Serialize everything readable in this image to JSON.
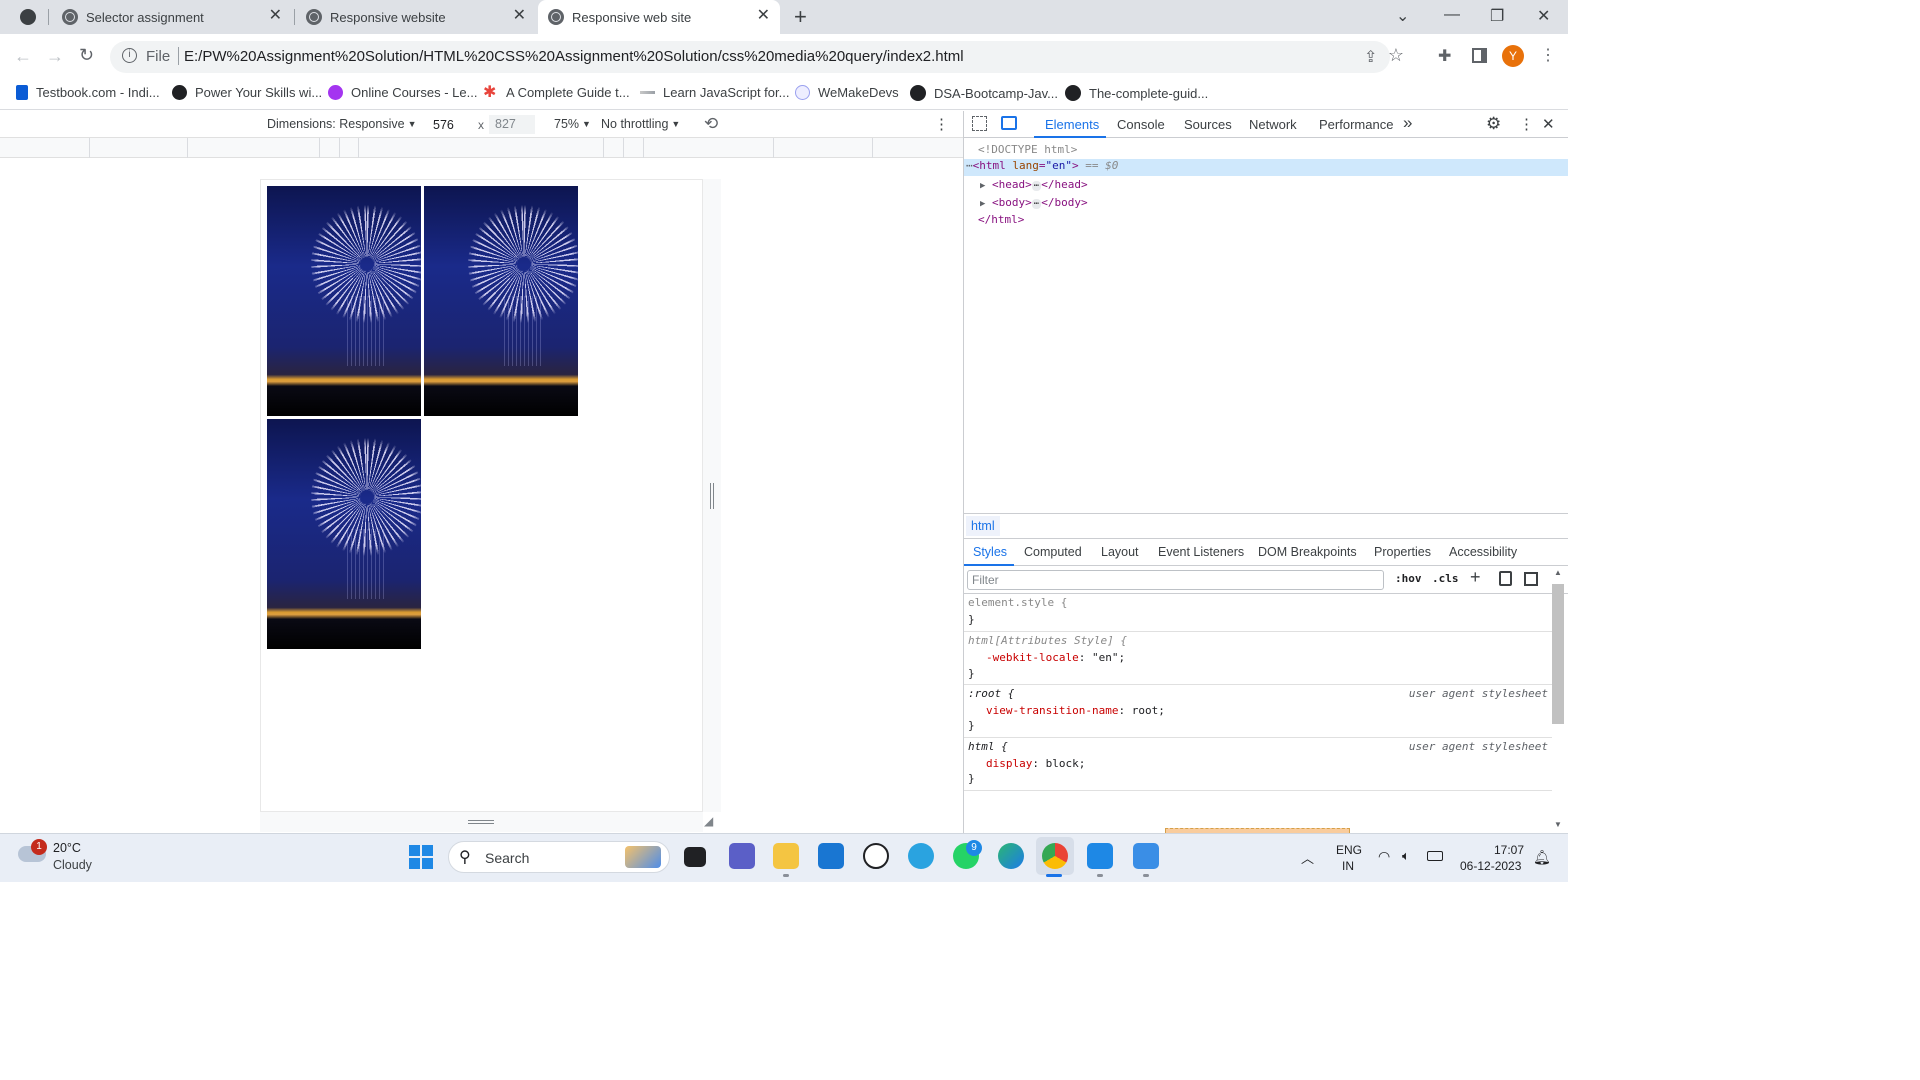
{
  "browser": {
    "tabs": [
      {
        "title": "Selector assignment"
      },
      {
        "title": "Responsive website"
      },
      {
        "title": "Responsive web site"
      }
    ],
    "new_tab_icon": "plus-icon",
    "address": {
      "scheme_label": "File",
      "url": "E:/PW%20Assignment%20Solution/HTML%20CSS%20Assignment%20Solution/css%20media%20query/index2.html"
    },
    "profile_initial": "Y",
    "profile_color": "#e8710a",
    "bookmarks": [
      {
        "label": "Testbook.com - Indi..."
      },
      {
        "label": "Power Your Skills wi..."
      },
      {
        "label": "Online Courses - Le..."
      },
      {
        "label": "A Complete Guide t..."
      },
      {
        "label": "Learn JavaScript for..."
      },
      {
        "label": "WeMakeDevs"
      },
      {
        "label": "DSA-Bootcamp-Jav..."
      },
      {
        "label": "The-complete-guid..."
      }
    ]
  },
  "device_toolbar": {
    "dimensions_label": "Dimensions: Responsive",
    "width": "576",
    "height_placeholder": "827",
    "times": "x",
    "zoom": "75%",
    "throttling": "No throttling"
  },
  "devtools": {
    "tabs": [
      "Elements",
      "Console",
      "Sources",
      "Network",
      "Performance"
    ],
    "active_tab": "Elements",
    "more_tabs": "»",
    "dom": {
      "doctype": "<!DOCTYPE html>",
      "html_open_tag": "<html",
      "html_attr": "lang",
      "html_attr_value": "\"en\"",
      "html_close_bracket": ">",
      "selected_marker": "== $0",
      "head": "<head>",
      "head_close": "</head>",
      "body": "<body>",
      "body_close": "</body>",
      "html_close": "</html>"
    },
    "breadcrumb": "html",
    "subtabs": [
      "Styles",
      "Computed",
      "Layout",
      "Event Listeners",
      "DOM Breakpoints",
      "Properties",
      "Accessibility"
    ],
    "active_subtab": "Styles",
    "filter_placeholder": "Filter",
    "hov_label": ":hov",
    "cls_label": ".cls",
    "rules": [
      {
        "selector": "element.style {",
        "close": "}"
      },
      {
        "selector": "html[Attributes Style] {",
        "prop": "-webkit-locale",
        "value": "\"en\";",
        "close": "}"
      },
      {
        "selector": ":root {",
        "prop": "view-transition-name",
        "value": "root;",
        "close": "}",
        "origin": "user agent stylesheet"
      },
      {
        "selector": "html {",
        "prop": "display",
        "value": "block;",
        "close": "}",
        "origin": "user agent stylesheet"
      }
    ]
  },
  "taskbar": {
    "weather_temp": "20°C",
    "weather_desc": "Cloudy",
    "weather_badge": "1",
    "search_label": "Search",
    "whatsapp_badge": "9",
    "lang_top": "ENG",
    "lang_bottom": "IN",
    "time": "17:07",
    "date": "06-12-2023"
  }
}
